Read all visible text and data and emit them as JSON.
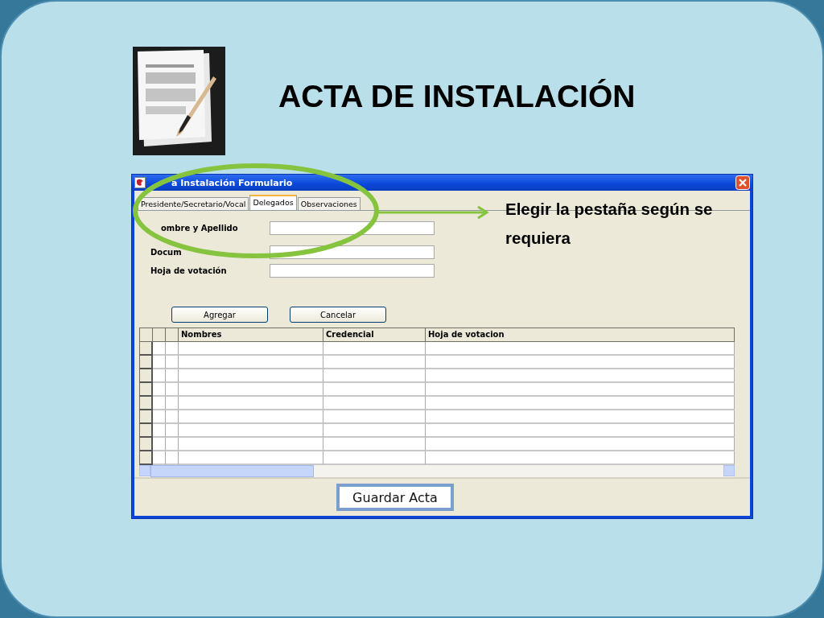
{
  "slide": {
    "title": "ACTA DE INSTALACIÓN"
  },
  "window": {
    "title": "a Instalación Formulario",
    "tabs": [
      {
        "label": "Presidente/Secretario/Vocal",
        "selected": false
      },
      {
        "label": "Delegados",
        "selected": true
      },
      {
        "label": "Observaciones",
        "selected": false
      }
    ],
    "fields": [
      {
        "label": "ombre y Apellido"
      },
      {
        "label": "Docum"
      },
      {
        "label": "Hoja de votación"
      }
    ],
    "buttons": [
      "Agregar",
      "Cancelar"
    ],
    "table": {
      "columns": [
        "Nombres",
        "Credencial",
        "Hoja de votacion"
      ]
    },
    "save_button": "Guardar Acta"
  },
  "callout": {
    "text": "Elegir la pestaña según se requiera"
  }
}
